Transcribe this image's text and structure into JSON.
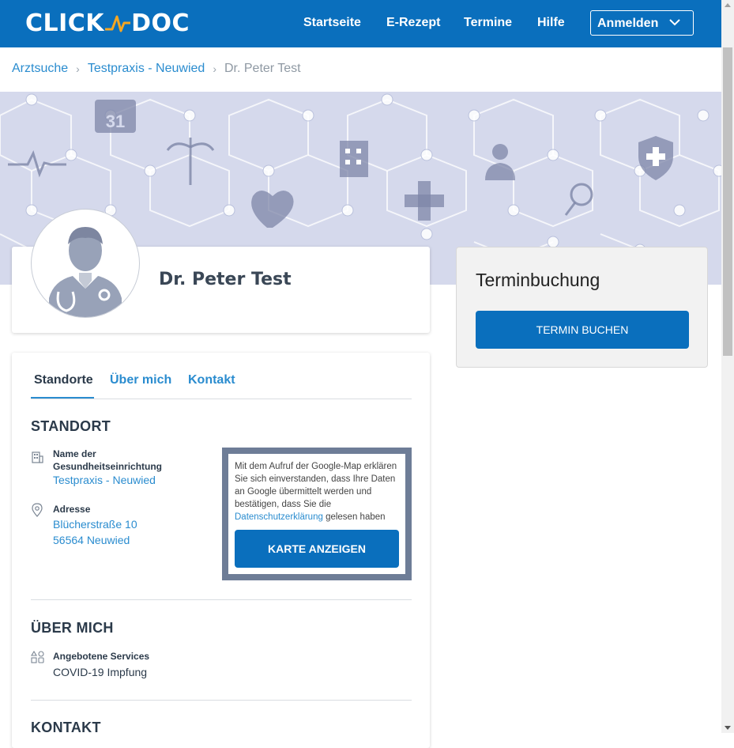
{
  "header": {
    "logo_left": "CLICK",
    "logo_right": "DOC",
    "nav": [
      "Startseite",
      "E-Rezept",
      "Termine",
      "Hilfe"
    ],
    "login_label": "Anmelden"
  },
  "breadcrumb": {
    "items": [
      "Arztsuche",
      "Testpraxis - Neuwied"
    ],
    "current": "Dr. Peter Test"
  },
  "profile": {
    "name": "Dr. Peter Test"
  },
  "hero": {
    "calendar_day": "31"
  },
  "booking": {
    "title": "Terminbuchung",
    "button_label": "TERMIN BUCHEN"
  },
  "tabs": [
    {
      "label": "Standorte",
      "active": true
    },
    {
      "label": "Über mich",
      "active": false
    },
    {
      "label": "Kontakt",
      "active": false
    }
  ],
  "standort": {
    "heading": "STANDORT",
    "facility_label_line1": "Name der",
    "facility_label_line2": "Gesundheitseinrichtung",
    "facility_value": "Testpraxis - Neuwied",
    "address_label": "Adresse",
    "address_line1": "Blücherstraße 10",
    "address_line2": "56564 Neuwied",
    "map_consent_text": "Mit dem Aufruf der Google-Map erklären Sie sich einverstanden, dass Ihre Daten an Google übermittelt werden und bestätigen, dass Sie die",
    "map_consent_link": "Datenschutzerklärung",
    "map_consent_suffix": " gelesen haben",
    "map_button": "KARTE ANZEIGEN"
  },
  "about": {
    "heading": "ÜBER MICH",
    "services_label": "Angebotene Services",
    "services_value": "COVID-19 Impfung"
  },
  "contact": {
    "heading": "KONTAKT"
  },
  "colors": {
    "brand_blue": "#0a6fbd",
    "link_blue": "#2a8ccf",
    "logo_accent": "#f5a623",
    "hero_bg": "#d5d9ec"
  }
}
